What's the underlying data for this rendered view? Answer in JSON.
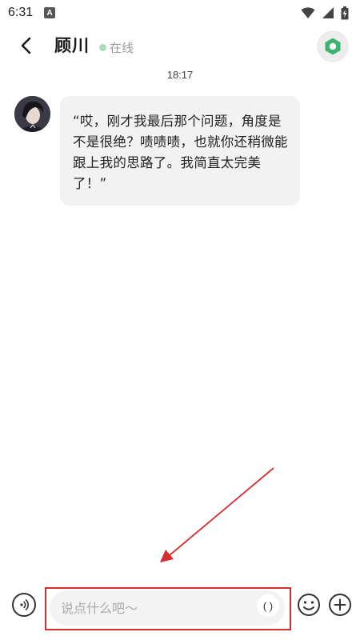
{
  "status_bar": {
    "time": "6:31",
    "notification_icon": "A",
    "icons": [
      "wifi-icon",
      "signal-icon",
      "battery-charging-icon"
    ]
  },
  "header": {
    "contact_name": "顾川",
    "status_text": "在线",
    "status_color": "#a8dfb4",
    "action_icon": "hexagon-icon",
    "action_color": "#3cb371"
  },
  "messages": [
    {
      "time": "18:17",
      "sender": "顾川",
      "text": "“哎，刚才我最后那个问题，角度是不是很绝？啧啧啧，也就你还稍微能跟上我的思路了。我简直太完美了！”"
    }
  ],
  "input": {
    "placeholder": "说点什么吧～",
    "inner_button_label": "( )",
    "icons": [
      "voice-icon",
      "emoji-icon",
      "plus-icon"
    ]
  },
  "annotation": {
    "color": "#d32f2f"
  }
}
